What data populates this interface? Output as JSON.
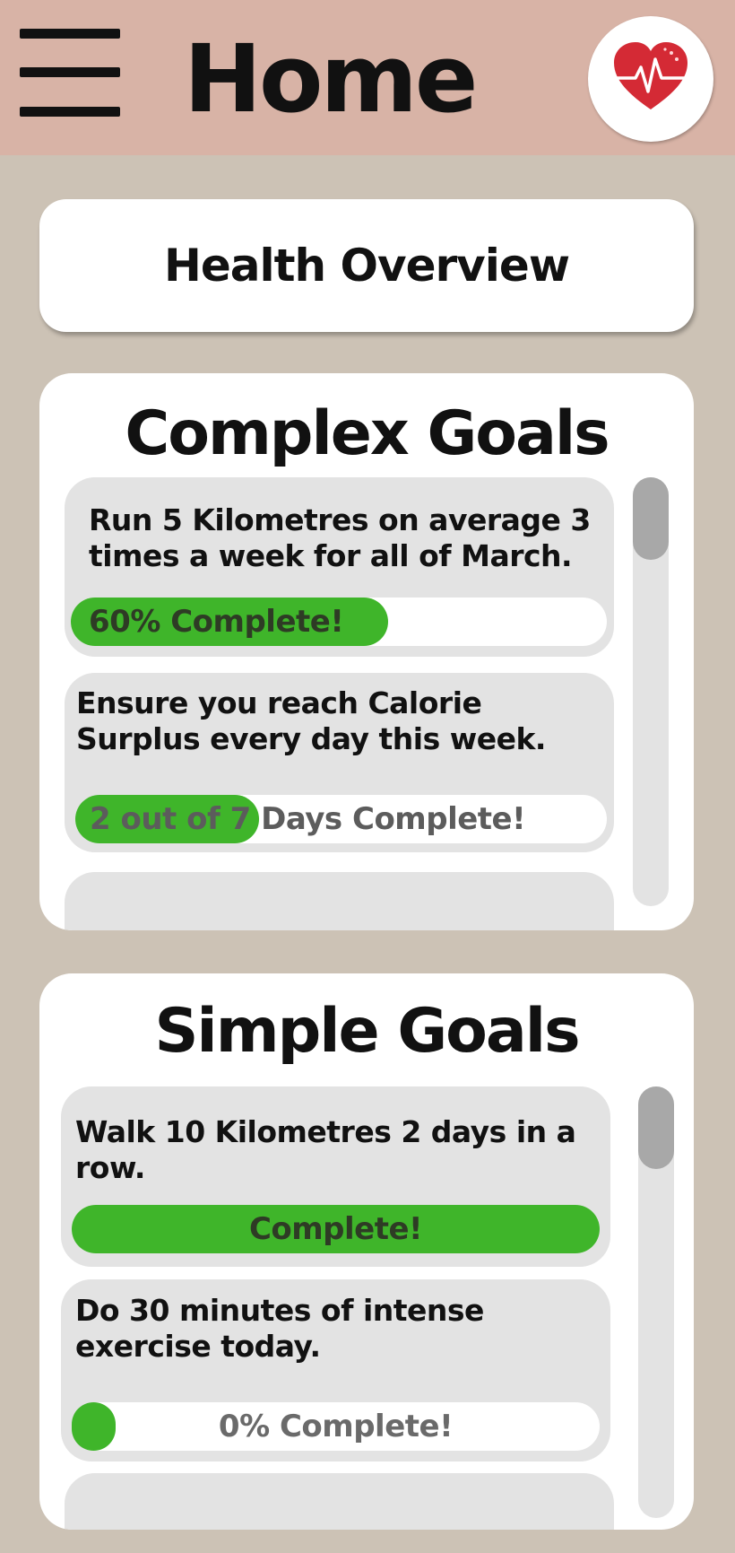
{
  "header": {
    "title": "Home",
    "menu_icon": "hamburger-menu-icon",
    "health_icon": "heart-rate-icon",
    "accent": "#d8b3a6"
  },
  "overview": {
    "label": "Health Overview"
  },
  "complex_goals": {
    "heading": "Complex Goals",
    "items": [
      {
        "text": "Run 5 Kilometres on average 3 times a week for all of March.",
        "progress_label": "60% Complete!",
        "progress": 0.6
      },
      {
        "text": "Ensure you reach Calorie Surplus every day this week.",
        "progress_label": "2 out of 7 Days Complete!",
        "progress": 0.2857
      }
    ]
  },
  "simple_goals": {
    "heading": "Simple Goals",
    "items": [
      {
        "text": "Walk 10 Kilometres 2 days in a row.",
        "progress_label": "Complete!",
        "progress": 1.0
      },
      {
        "text": "Do 30 minutes of intense exercise today.",
        "progress_label": "0% Complete!",
        "progress": 0.0
      }
    ]
  },
  "colors": {
    "background": "#ccc2b5",
    "progress_green": "#3fb52a",
    "item_grey": "#e3e3e3",
    "scroll_thumb": "#a8a8a8"
  }
}
